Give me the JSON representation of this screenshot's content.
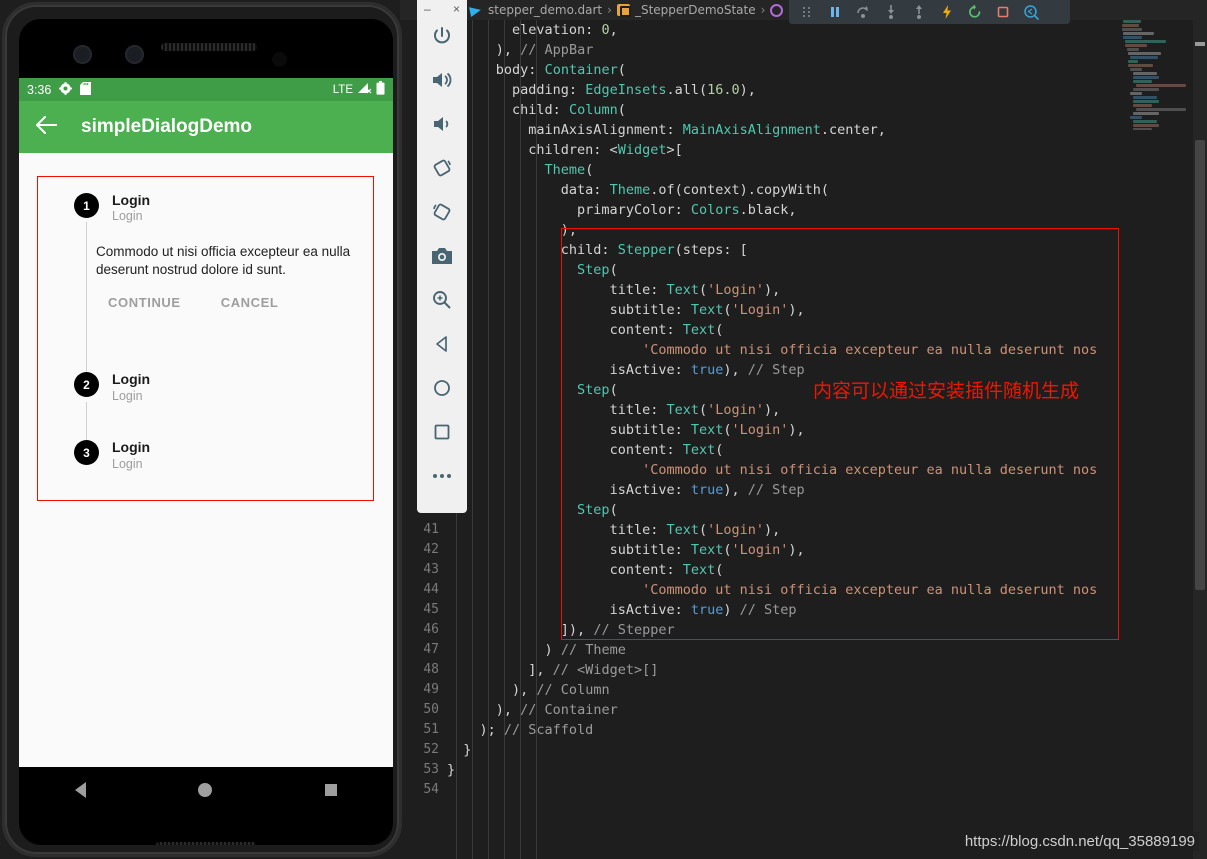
{
  "ide": {
    "breadcrumb": {
      "file": "stepper_demo.dart",
      "separator": "›",
      "class": "_StepperDemoState",
      "method": ""
    },
    "debug_toolbar": {
      "buttons": [
        {
          "name": "drag-handle-icon",
          "label": "drag"
        },
        {
          "name": "pause-icon",
          "label": "Pause"
        },
        {
          "name": "step-over-icon",
          "label": "Step Over"
        },
        {
          "name": "step-into-icon",
          "label": "Step Into"
        },
        {
          "name": "step-out-icon",
          "label": "Step Out"
        },
        {
          "name": "hot-reload-icon",
          "label": "Hot Reload"
        },
        {
          "name": "restart-icon",
          "label": "Hot Restart"
        },
        {
          "name": "stop-icon",
          "label": "Stop"
        },
        {
          "name": "inspect-widget-icon",
          "label": "Open DevTools"
        }
      ]
    },
    "annotation": "内容可以通过安装插件随机生成",
    "watermark": "https://blog.csdn.net/qq_35889199",
    "colors": {
      "editor_bg": "#1e1e1e",
      "highlight_red": "#f01000",
      "string": "#ce9178",
      "type": "#4ec9b0",
      "keyword_bool": "#569cd6",
      "comment": "#9a9a9a"
    },
    "gutter_line_numbers": [
      "41",
      "42",
      "43",
      "44",
      "45",
      "46",
      "47",
      "48",
      "49",
      "50",
      "51",
      "52",
      "53",
      "54"
    ],
    "code_lines": [
      {
        "indent": 4,
        "tokens": [
          {
            "t": "plain",
            "v": "elevation: "
          },
          {
            "t": "num",
            "v": "0"
          },
          {
            "t": "plain",
            "v": ","
          }
        ]
      },
      {
        "indent": 3,
        "tokens": [
          {
            "t": "plain",
            "v": "), "
          },
          {
            "t": "com",
            "v": "// AppBar"
          }
        ]
      },
      {
        "indent": 3,
        "tokens": [
          {
            "t": "plain",
            "v": "body: "
          },
          {
            "t": "type",
            "v": "Container"
          },
          {
            "t": "plain",
            "v": "("
          }
        ]
      },
      {
        "indent": 4,
        "tokens": [
          {
            "t": "plain",
            "v": "padding: "
          },
          {
            "t": "type",
            "v": "EdgeInsets"
          },
          {
            "t": "plain",
            "v": ".all("
          },
          {
            "t": "num",
            "v": "16.0"
          },
          {
            "t": "plain",
            "v": "),"
          }
        ]
      },
      {
        "indent": 4,
        "tokens": [
          {
            "t": "plain",
            "v": "child: "
          },
          {
            "t": "type",
            "v": "Column"
          },
          {
            "t": "plain",
            "v": "("
          }
        ]
      },
      {
        "indent": 5,
        "tokens": [
          {
            "t": "plain",
            "v": "mainAxisAlignment: "
          },
          {
            "t": "type",
            "v": "MainAxisAlignment"
          },
          {
            "t": "plain",
            "v": ".center,"
          }
        ]
      },
      {
        "indent": 5,
        "tokens": [
          {
            "t": "plain",
            "v": "children: <"
          },
          {
            "t": "type",
            "v": "Widget"
          },
          {
            "t": "plain",
            "v": ">["
          }
        ]
      },
      {
        "indent": 6,
        "tokens": [
          {
            "t": "type",
            "v": "Theme"
          },
          {
            "t": "plain",
            "v": "("
          }
        ]
      },
      {
        "indent": 7,
        "tokens": [
          {
            "t": "plain",
            "v": "data: "
          },
          {
            "t": "type",
            "v": "Theme"
          },
          {
            "t": "plain",
            "v": ".of(context).copyWith("
          }
        ]
      },
      {
        "indent": 8,
        "tokens": [
          {
            "t": "plain",
            "v": "primaryColor: "
          },
          {
            "t": "type",
            "v": "Colors"
          },
          {
            "t": "plain",
            "v": ".black,"
          }
        ]
      },
      {
        "indent": 7,
        "tokens": [
          {
            "t": "plain",
            "v": "),"
          }
        ]
      },
      {
        "indent": 7,
        "tokens": [
          {
            "t": "plain",
            "v": "child: "
          },
          {
            "t": "type",
            "v": "Stepper"
          },
          {
            "t": "plain",
            "v": "(steps: ["
          }
        ]
      },
      {
        "indent": 8,
        "tokens": [
          {
            "t": "type",
            "v": "Step"
          },
          {
            "t": "plain",
            "v": "("
          }
        ]
      },
      {
        "indent": 10,
        "tokens": [
          {
            "t": "plain",
            "v": "title: "
          },
          {
            "t": "type",
            "v": "Text"
          },
          {
            "t": "plain",
            "v": "("
          },
          {
            "t": "str",
            "v": "'Login'"
          },
          {
            "t": "plain",
            "v": "),"
          }
        ]
      },
      {
        "indent": 10,
        "tokens": [
          {
            "t": "plain",
            "v": "subtitle: "
          },
          {
            "t": "type",
            "v": "Text"
          },
          {
            "t": "plain",
            "v": "("
          },
          {
            "t": "str",
            "v": "'Login'"
          },
          {
            "t": "plain",
            "v": "),"
          }
        ]
      },
      {
        "indent": 10,
        "tokens": [
          {
            "t": "plain",
            "v": "content: "
          },
          {
            "t": "type",
            "v": "Text"
          },
          {
            "t": "plain",
            "v": "("
          }
        ]
      },
      {
        "indent": 12,
        "tokens": [
          {
            "t": "str",
            "v": "'Commodo ut nisi officia excepteur ea nulla deserunt nos"
          }
        ]
      },
      {
        "indent": 10,
        "tokens": [
          {
            "t": "plain",
            "v": "isActive: "
          },
          {
            "t": "bool",
            "v": "true"
          },
          {
            "t": "plain",
            "v": "), "
          },
          {
            "t": "com",
            "v": "// Step"
          }
        ]
      },
      {
        "indent": 8,
        "tokens": [
          {
            "t": "type",
            "v": "Step"
          },
          {
            "t": "plain",
            "v": "("
          }
        ]
      },
      {
        "indent": 10,
        "tokens": [
          {
            "t": "plain",
            "v": "title: "
          },
          {
            "t": "type",
            "v": "Text"
          },
          {
            "t": "plain",
            "v": "("
          },
          {
            "t": "str",
            "v": "'Login'"
          },
          {
            "t": "plain",
            "v": "),"
          }
        ]
      },
      {
        "indent": 10,
        "tokens": [
          {
            "t": "plain",
            "v": "subtitle: "
          },
          {
            "t": "type",
            "v": "Text"
          },
          {
            "t": "plain",
            "v": "("
          },
          {
            "t": "str",
            "v": "'Login'"
          },
          {
            "t": "plain",
            "v": "),"
          }
        ]
      },
      {
        "indent": 10,
        "tokens": [
          {
            "t": "plain",
            "v": "content: "
          },
          {
            "t": "type",
            "v": "Text"
          },
          {
            "t": "plain",
            "v": "("
          }
        ]
      },
      {
        "indent": 12,
        "tokens": [
          {
            "t": "str",
            "v": "'Commodo ut nisi officia excepteur ea nulla deserunt nos"
          }
        ]
      },
      {
        "indent": 10,
        "tokens": [
          {
            "t": "plain",
            "v": "isActive: "
          },
          {
            "t": "bool",
            "v": "true"
          },
          {
            "t": "plain",
            "v": "), "
          },
          {
            "t": "com",
            "v": "// Step"
          }
        ]
      },
      {
        "indent": 8,
        "tokens": [
          {
            "t": "type",
            "v": "Step"
          },
          {
            "t": "plain",
            "v": "("
          }
        ]
      },
      {
        "indent": 10,
        "tokens": [
          {
            "t": "plain",
            "v": "title: "
          },
          {
            "t": "type",
            "v": "Text"
          },
          {
            "t": "plain",
            "v": "("
          },
          {
            "t": "str",
            "v": "'Login'"
          },
          {
            "t": "plain",
            "v": "),"
          }
        ]
      },
      {
        "indent": 10,
        "tokens": [
          {
            "t": "plain",
            "v": "subtitle: "
          },
          {
            "t": "type",
            "v": "Text"
          },
          {
            "t": "plain",
            "v": "("
          },
          {
            "t": "str",
            "v": "'Login'"
          },
          {
            "t": "plain",
            "v": "),"
          }
        ]
      },
      {
        "indent": 10,
        "tokens": [
          {
            "t": "plain",
            "v": "content: "
          },
          {
            "t": "type",
            "v": "Text"
          },
          {
            "t": "plain",
            "v": "("
          }
        ]
      },
      {
        "indent": 12,
        "tokens": [
          {
            "t": "str",
            "v": "'Commodo ut nisi officia excepteur ea nulla deserunt nos"
          }
        ]
      },
      {
        "indent": 10,
        "tokens": [
          {
            "t": "plain",
            "v": "isActive: "
          },
          {
            "t": "bool",
            "v": "true"
          },
          {
            "t": "plain",
            "v": ") "
          },
          {
            "t": "com",
            "v": "// Step"
          }
        ]
      },
      {
        "indent": 7,
        "tokens": [
          {
            "t": "plain",
            "v": "]), "
          },
          {
            "t": "com",
            "v": "// Stepper"
          }
        ]
      },
      {
        "indent": 6,
        "tokens": [
          {
            "t": "plain",
            "v": ") "
          },
          {
            "t": "com",
            "v": "// Theme"
          }
        ]
      },
      {
        "indent": 5,
        "tokens": [
          {
            "t": "plain",
            "v": "], "
          },
          {
            "t": "com",
            "v": "// <Widget>[]"
          }
        ]
      },
      {
        "indent": 4,
        "tokens": [
          {
            "t": "plain",
            "v": "), "
          },
          {
            "t": "com",
            "v": "// Column"
          }
        ]
      },
      {
        "indent": 3,
        "tokens": [
          {
            "t": "plain",
            "v": "), "
          },
          {
            "t": "com",
            "v": "// Container"
          }
        ]
      },
      {
        "indent": 2,
        "tokens": [
          {
            "t": "plain",
            "v": "); "
          },
          {
            "t": "com",
            "v": "// Scaffold"
          }
        ]
      },
      {
        "indent": 1,
        "tokens": [
          {
            "t": "plain",
            "v": "}"
          }
        ]
      },
      {
        "indent": 0,
        "tokens": [
          {
            "t": "plain",
            "v": "}"
          }
        ]
      },
      {
        "indent": 0,
        "tokens": []
      }
    ]
  },
  "emulator_toolbar": {
    "minimize_label": "–",
    "close_label": "×",
    "buttons": [
      {
        "name": "power-icon",
        "label": "Power"
      },
      {
        "name": "volume-up-icon",
        "label": "Volume Up"
      },
      {
        "name": "volume-down-icon",
        "label": "Volume Down"
      },
      {
        "name": "rotate-left-icon",
        "label": "Rotate Left"
      },
      {
        "name": "rotate-right-icon",
        "label": "Rotate Right"
      },
      {
        "name": "screenshot-camera-icon",
        "label": "Take Screenshot"
      },
      {
        "name": "zoom-icon",
        "label": "Zoom Mode"
      },
      {
        "name": "back-icon",
        "label": "Back"
      },
      {
        "name": "home-icon",
        "label": "Home"
      },
      {
        "name": "overview-icon",
        "label": "Overview"
      },
      {
        "name": "more-icon",
        "label": "More"
      }
    ]
  },
  "phone": {
    "status_bar": {
      "time": "3:36",
      "gear_icon": "gear-icon",
      "sd_icon": "sd-card-icon",
      "network": "LTE",
      "signal_icon": "signal-icon",
      "battery_icon": "battery-icon"
    },
    "appbar": {
      "back_icon": "back-arrow-icon",
      "title": "simpleDialogDemo",
      "color": "#4caf50"
    },
    "stepper": {
      "steps": [
        {
          "number": "1",
          "title": "Login",
          "subtitle": "Login",
          "content": "Commodo ut nisi officia excepteur ea nulla deserunt nostrud dolore id sunt.",
          "continue_label": "CONTINUE",
          "cancel_label": "CANCEL",
          "active": true
        },
        {
          "number": "2",
          "title": "Login",
          "subtitle": "Login",
          "content": "",
          "active": false
        },
        {
          "number": "3",
          "title": "Login",
          "subtitle": "Login",
          "content": "",
          "active": false
        }
      ]
    },
    "navbar": {
      "back": "back-triangle-icon",
      "home": "home-circle-icon",
      "recent": "recents-square-icon"
    }
  }
}
